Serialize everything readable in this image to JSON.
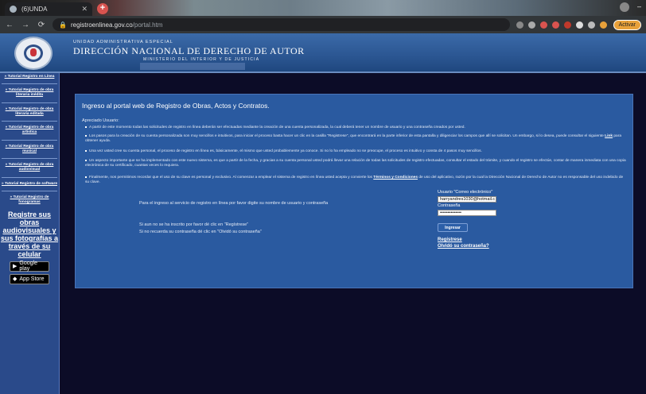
{
  "browser": {
    "tab_title": "(6)UNDA",
    "url_host": "registroenlinea.gov.co",
    "url_path": "/portal.htm",
    "activate_label": "Activar"
  },
  "header": {
    "sup": "UNIDAD ADMINISTRATIVA ESPECIAL",
    "title": "DIRECCIÓN NACIONAL DE DERECHO DE AUTOR",
    "sub": "MINISTERIO DEL INTERIOR Y DE JUSTICIA"
  },
  "sidebar": {
    "links": [
      "» Tutorial Registro en Línea",
      "» Tutorial Registro de obra literaria inédita",
      "» Tutorial Registro de obra literaria editada",
      "» Tutorial Registro de obra artística",
      "» Tutorial Registro de obra musical",
      "» Tutorial Registro de obra audiovisual",
      "» Tutorial Registro de software",
      "» Tutorial Registro de fonogramas"
    ],
    "promo": "Registre sus obras audiovisuales y sus fotografías a través de su celular",
    "google_play": "Google play",
    "app_store": "App Store"
  },
  "content": {
    "title": "Ingreso al portal web de Registro de Obras, Actos y Contratos.",
    "greeting": "Apreciado Usuario:",
    "p1": "A partir de este momento todas las solicitudes de registro en línea deberán ser efectuadas mediante la creación de una cuenta personalizada, la cual deberá tener un nombre de usuario y una contraseña creados por usted.",
    "p2": "Los pasos para la creación de su cuenta personalizada son muy sencillos e intuitivos, para iniciar el proceso basta hacer un clic en la casilla \"Registrese\", que encontrará en la parte inferior de esta pantalla y diligenciar los campos que allí se solicitan. Un embargo, si lo desea, puede consultar el siguiente",
    "p2_link": "Link",
    "p2_end": "para obtener ayuda.",
    "p3": "Una vez usted cree su cuenta personal, el proceso de registro en línea es, básicamente, el mismo que usted probablemente ya conoce. Si no lo ha empleado no se preocupe, el proceso es intuitivo y consta de 4 pasos muy sencillos.",
    "p4": "Un aspecto importante que se ha implementado con este nuevo sistema, es que a partir de la fecha, y gracias a su cuenta personal usted podrá llevar una relación de todas las solicitudes de registro efectuadas, consultar el estado del trámite, y cuando el registro se efectúe, contar de manera inmediata con una copia electrónica de su certificado, cuantas veces lo requiera.",
    "p5": "Finalmente, nos permitimos recordar que el uso de su clave es personal y exclusivo. Al comenzar a emplear el sistema de registro en línea usted acepta y convierte los",
    "p5_link": "Términos y Condiciones",
    "p5_end": "de uso del aplicativo, razón por la cual la Dirección Nacional de Derecho de Autor no es responsable del uso indebido de su clave.",
    "login_prompt": "Para el ingreso al servicio de registro en línea por favor digite su nombre de usuario y contraseña",
    "not_registered": "Si aun no se ha inscrito por favor dé clic en \"Regístrese\"",
    "forgot_prompt": "Si no recuerda su contraseña dé clic en \"Olvidó su contraseña\"",
    "user_label": "Usuario \"Correo electrónico\"",
    "user_value": "harryandres1030@hotmail.c",
    "pass_label": "Contraseña",
    "pass_value": "••••••••••••••",
    "submit": "Ingresar",
    "register": "Regístrese",
    "forgot": "Olvidó su contraseña?"
  }
}
